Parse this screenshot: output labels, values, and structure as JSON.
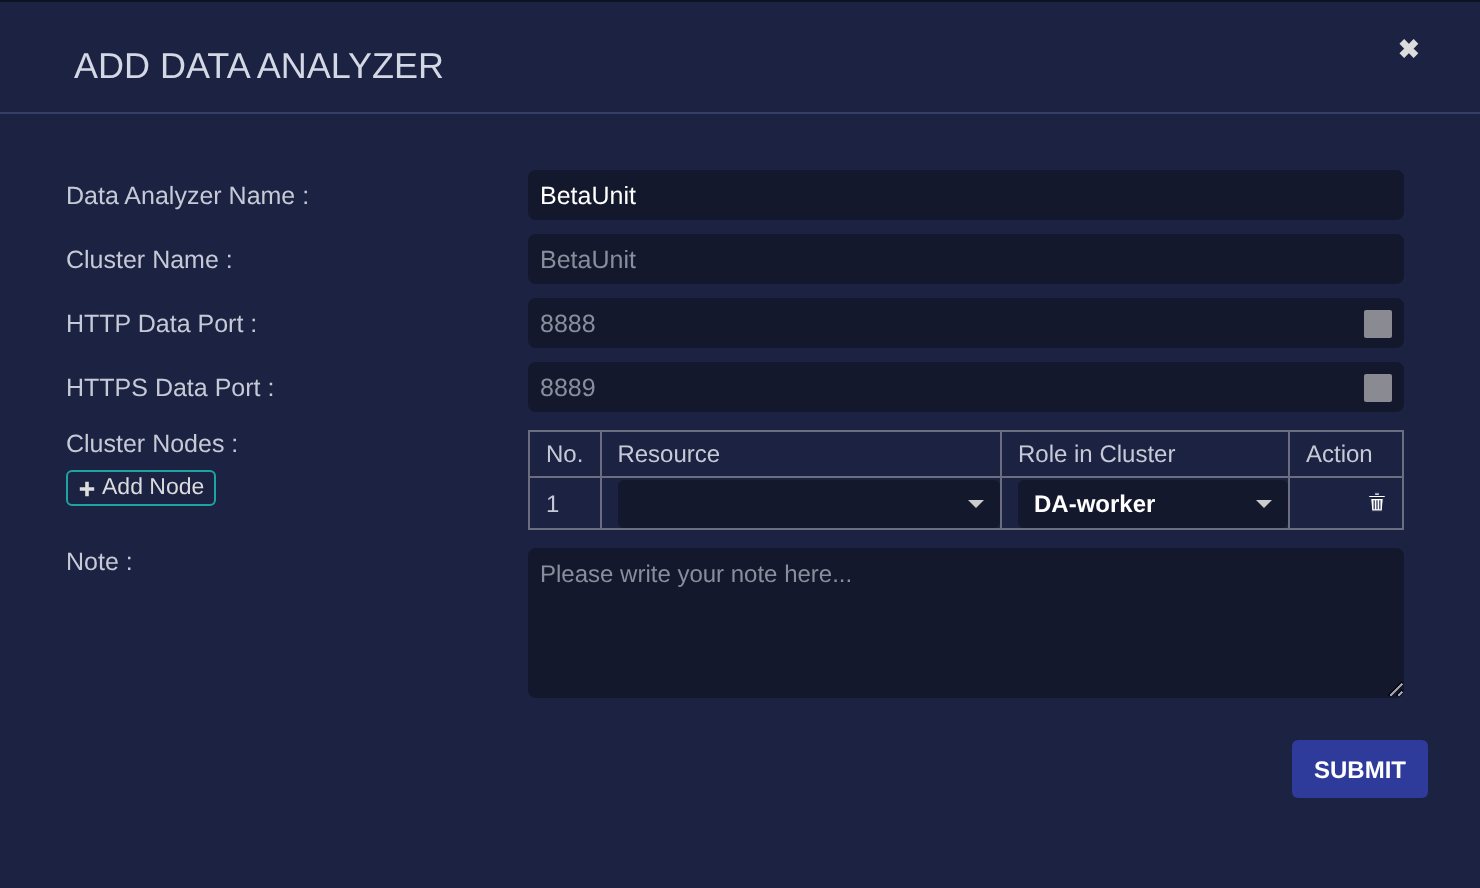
{
  "dialog": {
    "title": "ADD DATA ANALYZER",
    "close": "✖"
  },
  "fields": [
    {
      "label": "Data Analyzer Name :",
      "kind": "text",
      "value": "BetaUnit",
      "disabled": false
    },
    {
      "label": "Cluster Name :",
      "kind": "text",
      "value": "BetaUnit",
      "disabled": true
    },
    {
      "label": "HTTP Data Port :",
      "kind": "number",
      "value": "8888",
      "disabled": true
    },
    {
      "label": "HTTPS Data Port :",
      "kind": "number",
      "value": "8889",
      "disabled": true
    }
  ],
  "cluster_nodes": {
    "label": "Cluster Nodes :",
    "add_button": "Add Node",
    "columns": [
      "No.",
      "Resource",
      "Role in Cluster",
      "Action"
    ],
    "rows": [
      {
        "no": "1",
        "role": "DA-worker"
      }
    ]
  },
  "note": {
    "label": "Note :",
    "placeholder": "Please write your note here..."
  },
  "submit": "SUBMIT"
}
